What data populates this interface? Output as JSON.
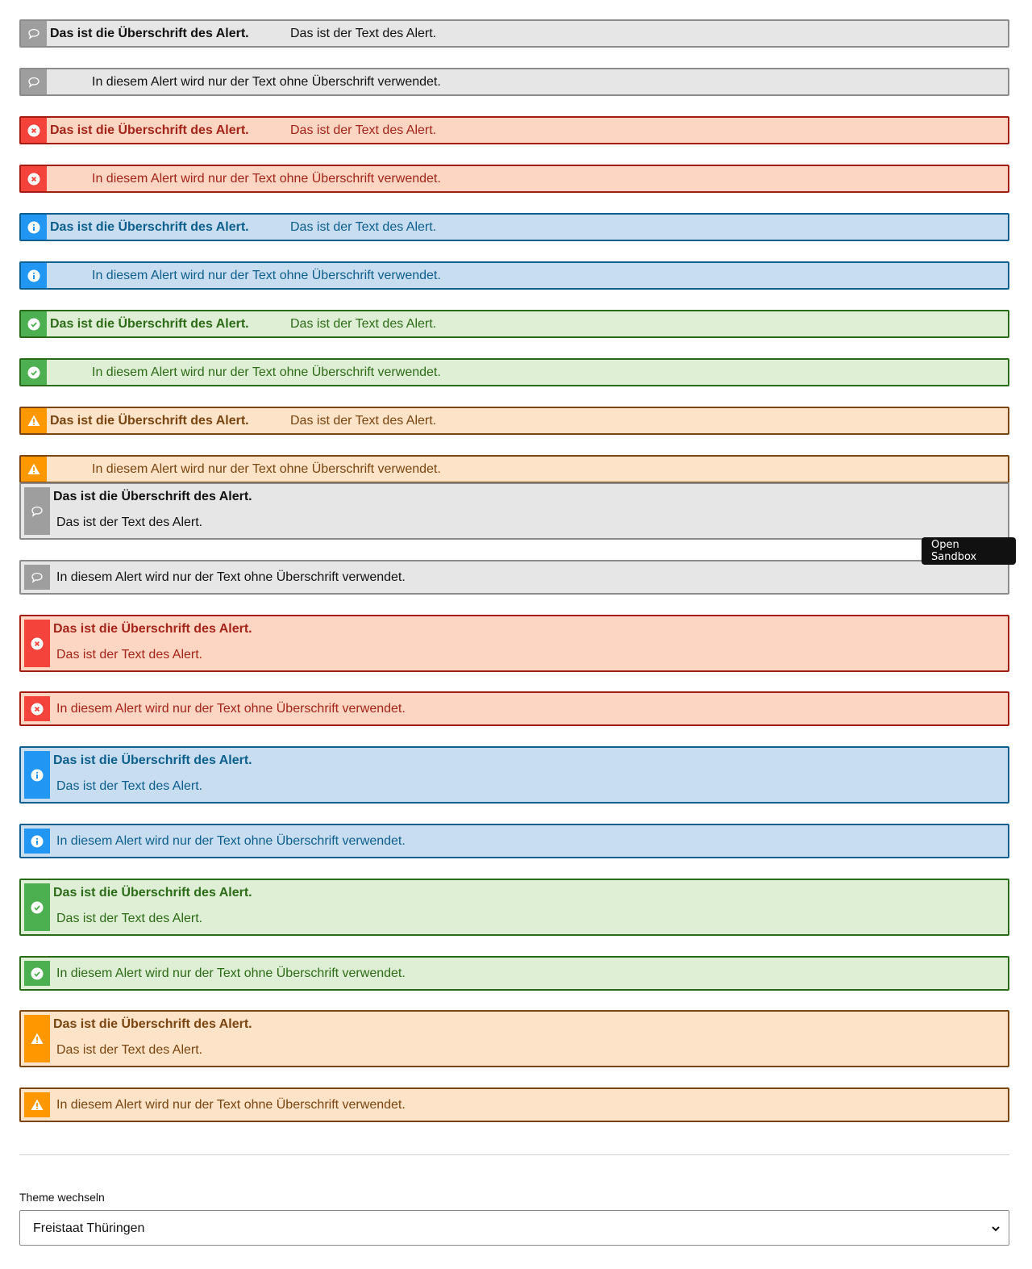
{
  "alert": {
    "title": "Das ist die Überschrift des Alert.",
    "text": "Das ist der Text des Alert.",
    "text_only": "In diesem Alert wird nur der Text ohne Überschrift verwendet."
  },
  "variants": [
    {
      "theme": "default",
      "icon": "comment-icon",
      "icon_color": "#9e9e9e"
    },
    {
      "theme": "error",
      "icon": "close-circle-icon",
      "icon_color": "#f3433b"
    },
    {
      "theme": "info",
      "icon": "info-circle-icon",
      "icon_color": "#2196f3"
    },
    {
      "theme": "success",
      "icon": "check-circle-icon",
      "icon_color": "#4caf50"
    },
    {
      "theme": "warning",
      "icon": "warning-triangle-icon",
      "icon_color": "#ff9800"
    }
  ],
  "sandbox": {
    "label": "Open Sandbox"
  },
  "theme_switch": {
    "label": "Theme wechseln",
    "selected": "Freistaat Thüringen"
  }
}
